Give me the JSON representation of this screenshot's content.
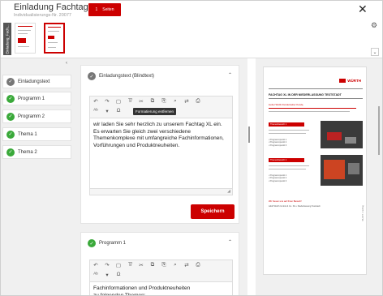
{
  "header": {
    "title": "Einladung Fachtag XL",
    "subtitle": "Individualisierungs-Nr. 20077",
    "pages_count": "1",
    "pages_label": "Seiten",
    "vertical_tab": "Einladung_Fach...",
    "close_icon": "close-icon",
    "gear_icon": "gear-icon",
    "collapse_icon": "chevron-down-icon"
  },
  "sidebar": {
    "toggle_icon": "chevron-left-icon",
    "items": [
      {
        "label": "Einladungstext",
        "state": "gray"
      },
      {
        "label": "Programm 1",
        "state": "green"
      },
      {
        "label": "Programm 2",
        "state": "green"
      },
      {
        "label": "Thema 1",
        "state": "green"
      },
      {
        "label": "Thema 2",
        "state": "green"
      }
    ]
  },
  "cards": [
    {
      "title": "Einladungstext (Blindtext)",
      "tooltip": "Formatierung entfernen",
      "text": "wir laden Sie sehr herzlich zu unserem Fachtag XL ein. Es erwarten Sie gleich zwei verschiedene Themenkomplexe mit umfangreiche Fachinformationen, Vorführungen und Produktneuheiten.",
      "save_label": "Speichern"
    },
    {
      "title": "Programm 1",
      "text": "Fachinformationen und Produktneuheiten\nzu folgenden Themen:"
    }
  ],
  "preview": {
    "brand": "WÜRTH",
    "doc_title": "FACHTAG XL IN DER NIEDERLASSUNG TESTSTADT",
    "greeting": "Lieber Würth-Kunde/Lieber Kunde,",
    "banner1": "Themenbereich 1",
    "banner2": "Themenbereich 2",
    "bullets": [
      "• Programmpunkt 1",
      "• Programmpunkt 2",
      "• Programmpunkt 3"
    ],
    "footer_red": "Wir freuen uns auf Ihren Besuch!",
    "footer_small": "Adolf Würth GmbH & Co. KG • Niederlassung Teststadt",
    "side_text": "WÜRTH • Fachtag"
  },
  "colors": {
    "accent": "#cc0000",
    "check_done": "#3aa93a",
    "check_pending": "#777777"
  }
}
